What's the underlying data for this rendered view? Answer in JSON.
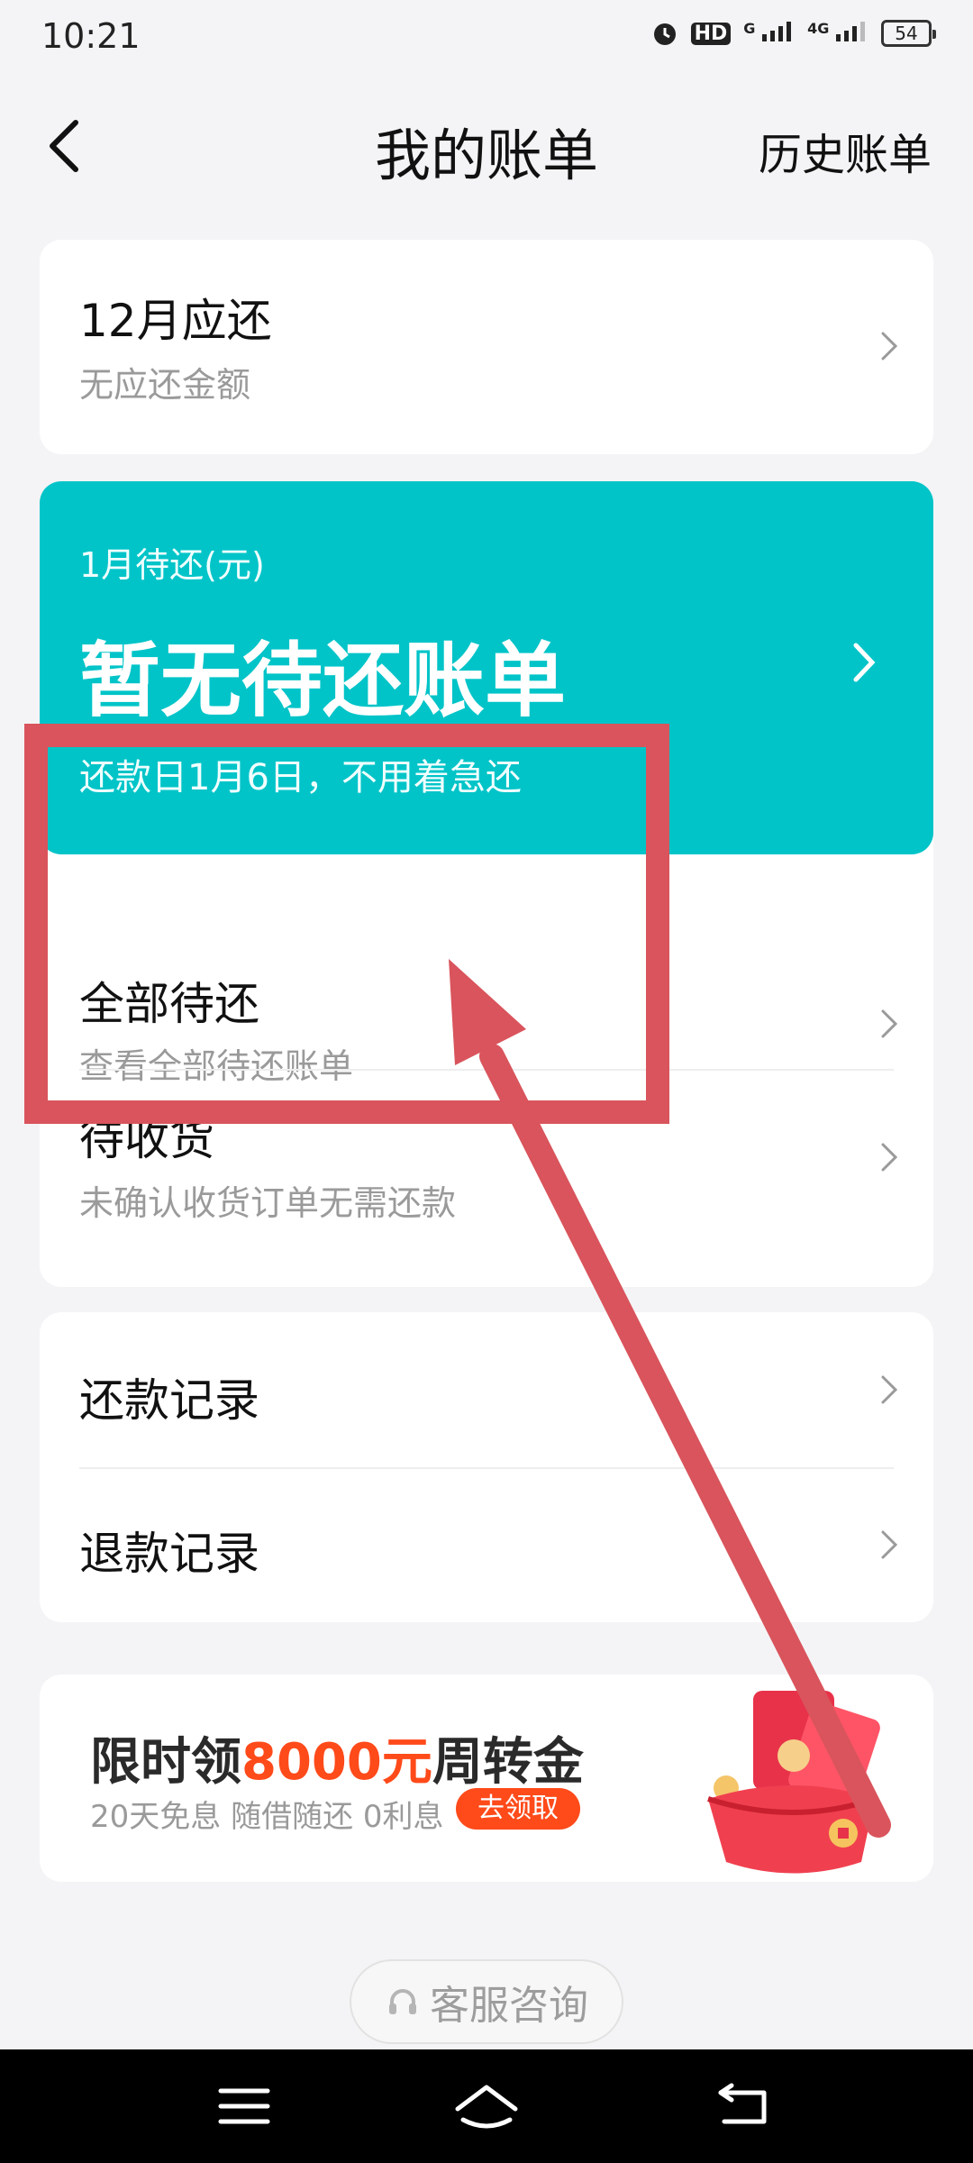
{
  "status_bar": {
    "time": "10:21",
    "hd_icon": "HD",
    "signal1": "G",
    "signal2": "4G",
    "battery": "54"
  },
  "header": {
    "title": "我的账单",
    "history_link": "历史账单"
  },
  "current_due": {
    "title": "12月应还",
    "subtitle": "无应还金额"
  },
  "upcoming": {
    "label": "1月待还(元)",
    "status": "暂无待还账单",
    "note": "还款日1月6日，不用着急还"
  },
  "list1": [
    {
      "title": "全部待还",
      "subtitle": "查看全部待还账单"
    },
    {
      "title": "待收货",
      "subtitle": "未确认收货订单无需还款"
    }
  ],
  "list2": [
    {
      "title": "还款记录"
    },
    {
      "title": "退款记录"
    }
  ],
  "promo": {
    "title_prefix": "限时领",
    "title_amount": "8000元",
    "title_suffix": "周转金",
    "subtitle": "20天免息 随借随还 0利息",
    "button": "去领取"
  },
  "customer_service": {
    "label": "客服咨询"
  },
  "colors": {
    "teal": "#00c4c8",
    "accent": "#ff4a1a",
    "annotation": "#d9545c"
  }
}
